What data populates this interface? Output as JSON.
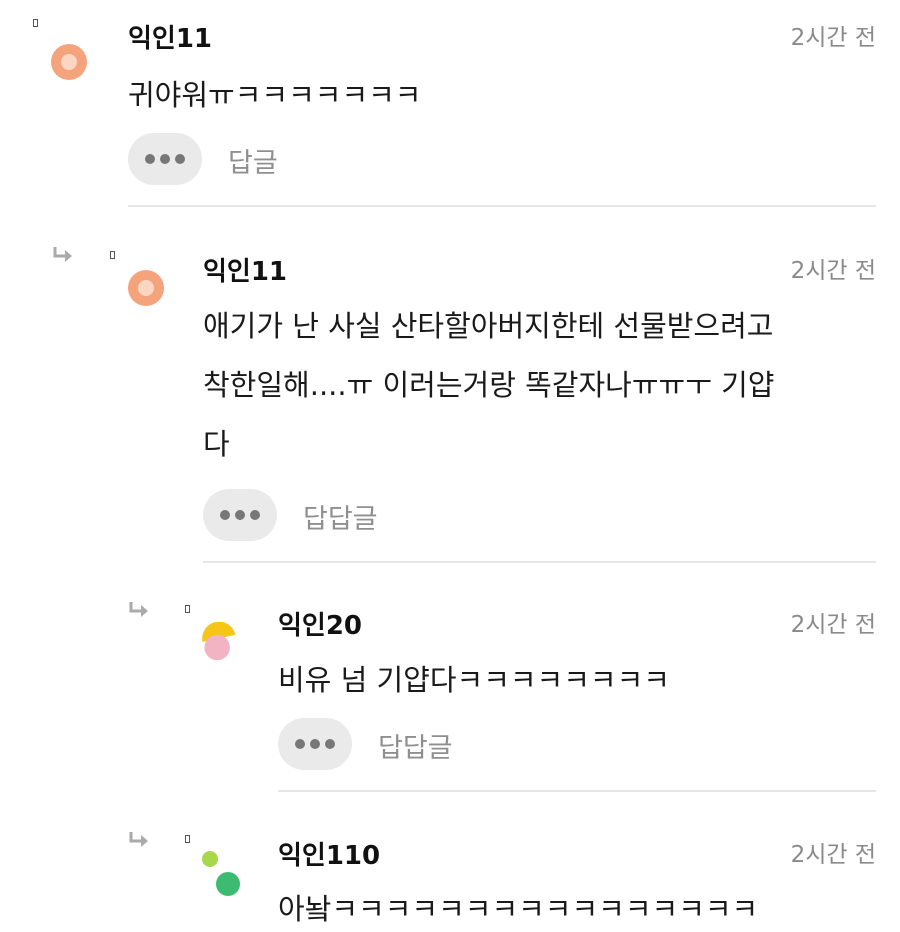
{
  "comments": [
    {
      "nickname": "익인11",
      "time": "2시간 전",
      "text": "귀야워ㅠㅋㅋㅋㅋㅋㅋㅋ",
      "reply_label": "답글",
      "avatar_icon": "orange-circle-avatar-icon"
    },
    {
      "nickname": "익인11",
      "time": "2시간 전",
      "text": "애기가 난 사실 산타할아버지한테 선물받으려고\n착한일해....ㅠ 이러는거랑 똑같자나ㅠㅠㅜ 기얍\n다",
      "reply_label": "답답글",
      "avatar_icon": "orange-circle-avatar-icon"
    },
    {
      "nickname": "익인20",
      "time": "2시간 전",
      "text": "비유 넘 기얍다ㅋㅋㅋㅋㅋㅋㅋㅋ",
      "reply_label": "답답글",
      "avatar_icon": "yellow-pink-avatar-icon"
    },
    {
      "nickname": "익인110",
      "time": "2시간 전",
      "text": "아놬ㅋㅋㅋㅋㅋㅋㅋㅋㅋㅋㅋㅋㅋㅋㅋㅋ",
      "avatar_icon": "green-dots-avatar-icon"
    }
  ],
  "colors": {
    "orange_avatar": "#f5a37c",
    "yellow": "#f5c518",
    "pink": "#f2b3c3",
    "light_green": "#a8d84a",
    "green": "#3dbb73"
  }
}
